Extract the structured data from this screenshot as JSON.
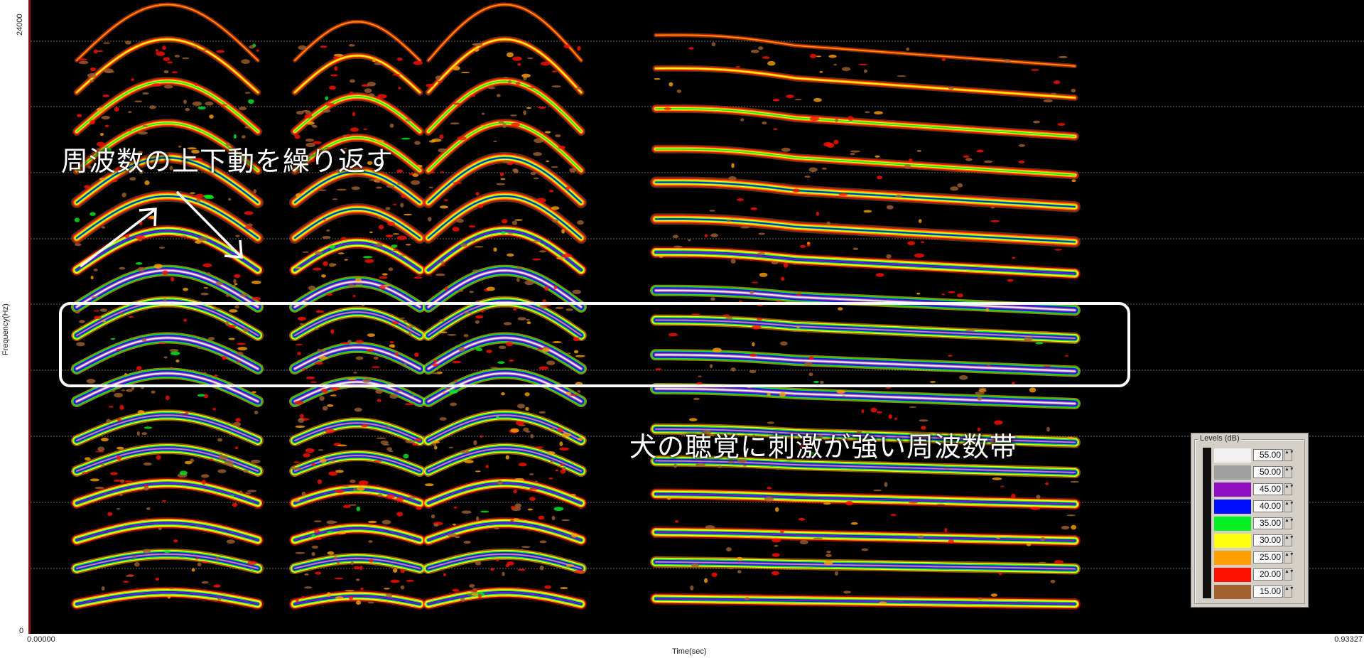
{
  "chart_data": {
    "type": "heatmap",
    "title": "",
    "xlabel": "Time(sec)",
    "ylabel": "Frequency(Hz)",
    "xlim": [
      0.0,
      0.93327
    ],
    "ylim": [
      0,
      24000
    ],
    "x_tick_labels": [
      "0.00000",
      "0.93327"
    ],
    "y_tick_labels": [
      "0",
      "24000"
    ],
    "grid": true,
    "legend": {
      "title": "Levels (dB)",
      "placement": "bottom-right",
      "levels": [
        {
          "value": "55.00",
          "color": "#f0f0f0"
        },
        {
          "value": "50.00",
          "color": "#a0a0a0"
        },
        {
          "value": "45.00",
          "color": "#9010c0"
        },
        {
          "value": "40.00",
          "color": "#0010ff"
        },
        {
          "value": "35.00",
          "color": "#00f020"
        },
        {
          "value": "30.00",
          "color": "#ffff10"
        },
        {
          "value": "25.00",
          "color": "#ffa000"
        },
        {
          "value": "20.00",
          "color": "#ff1000"
        },
        {
          "value": "15.00",
          "color": "#a06030"
        }
      ]
    },
    "annotations": [
      {
        "text": "周波数の上下動を繰り返す"
      },
      {
        "text": "犬の聴覚に刺激が強い周波数帯"
      }
    ]
  }
}
